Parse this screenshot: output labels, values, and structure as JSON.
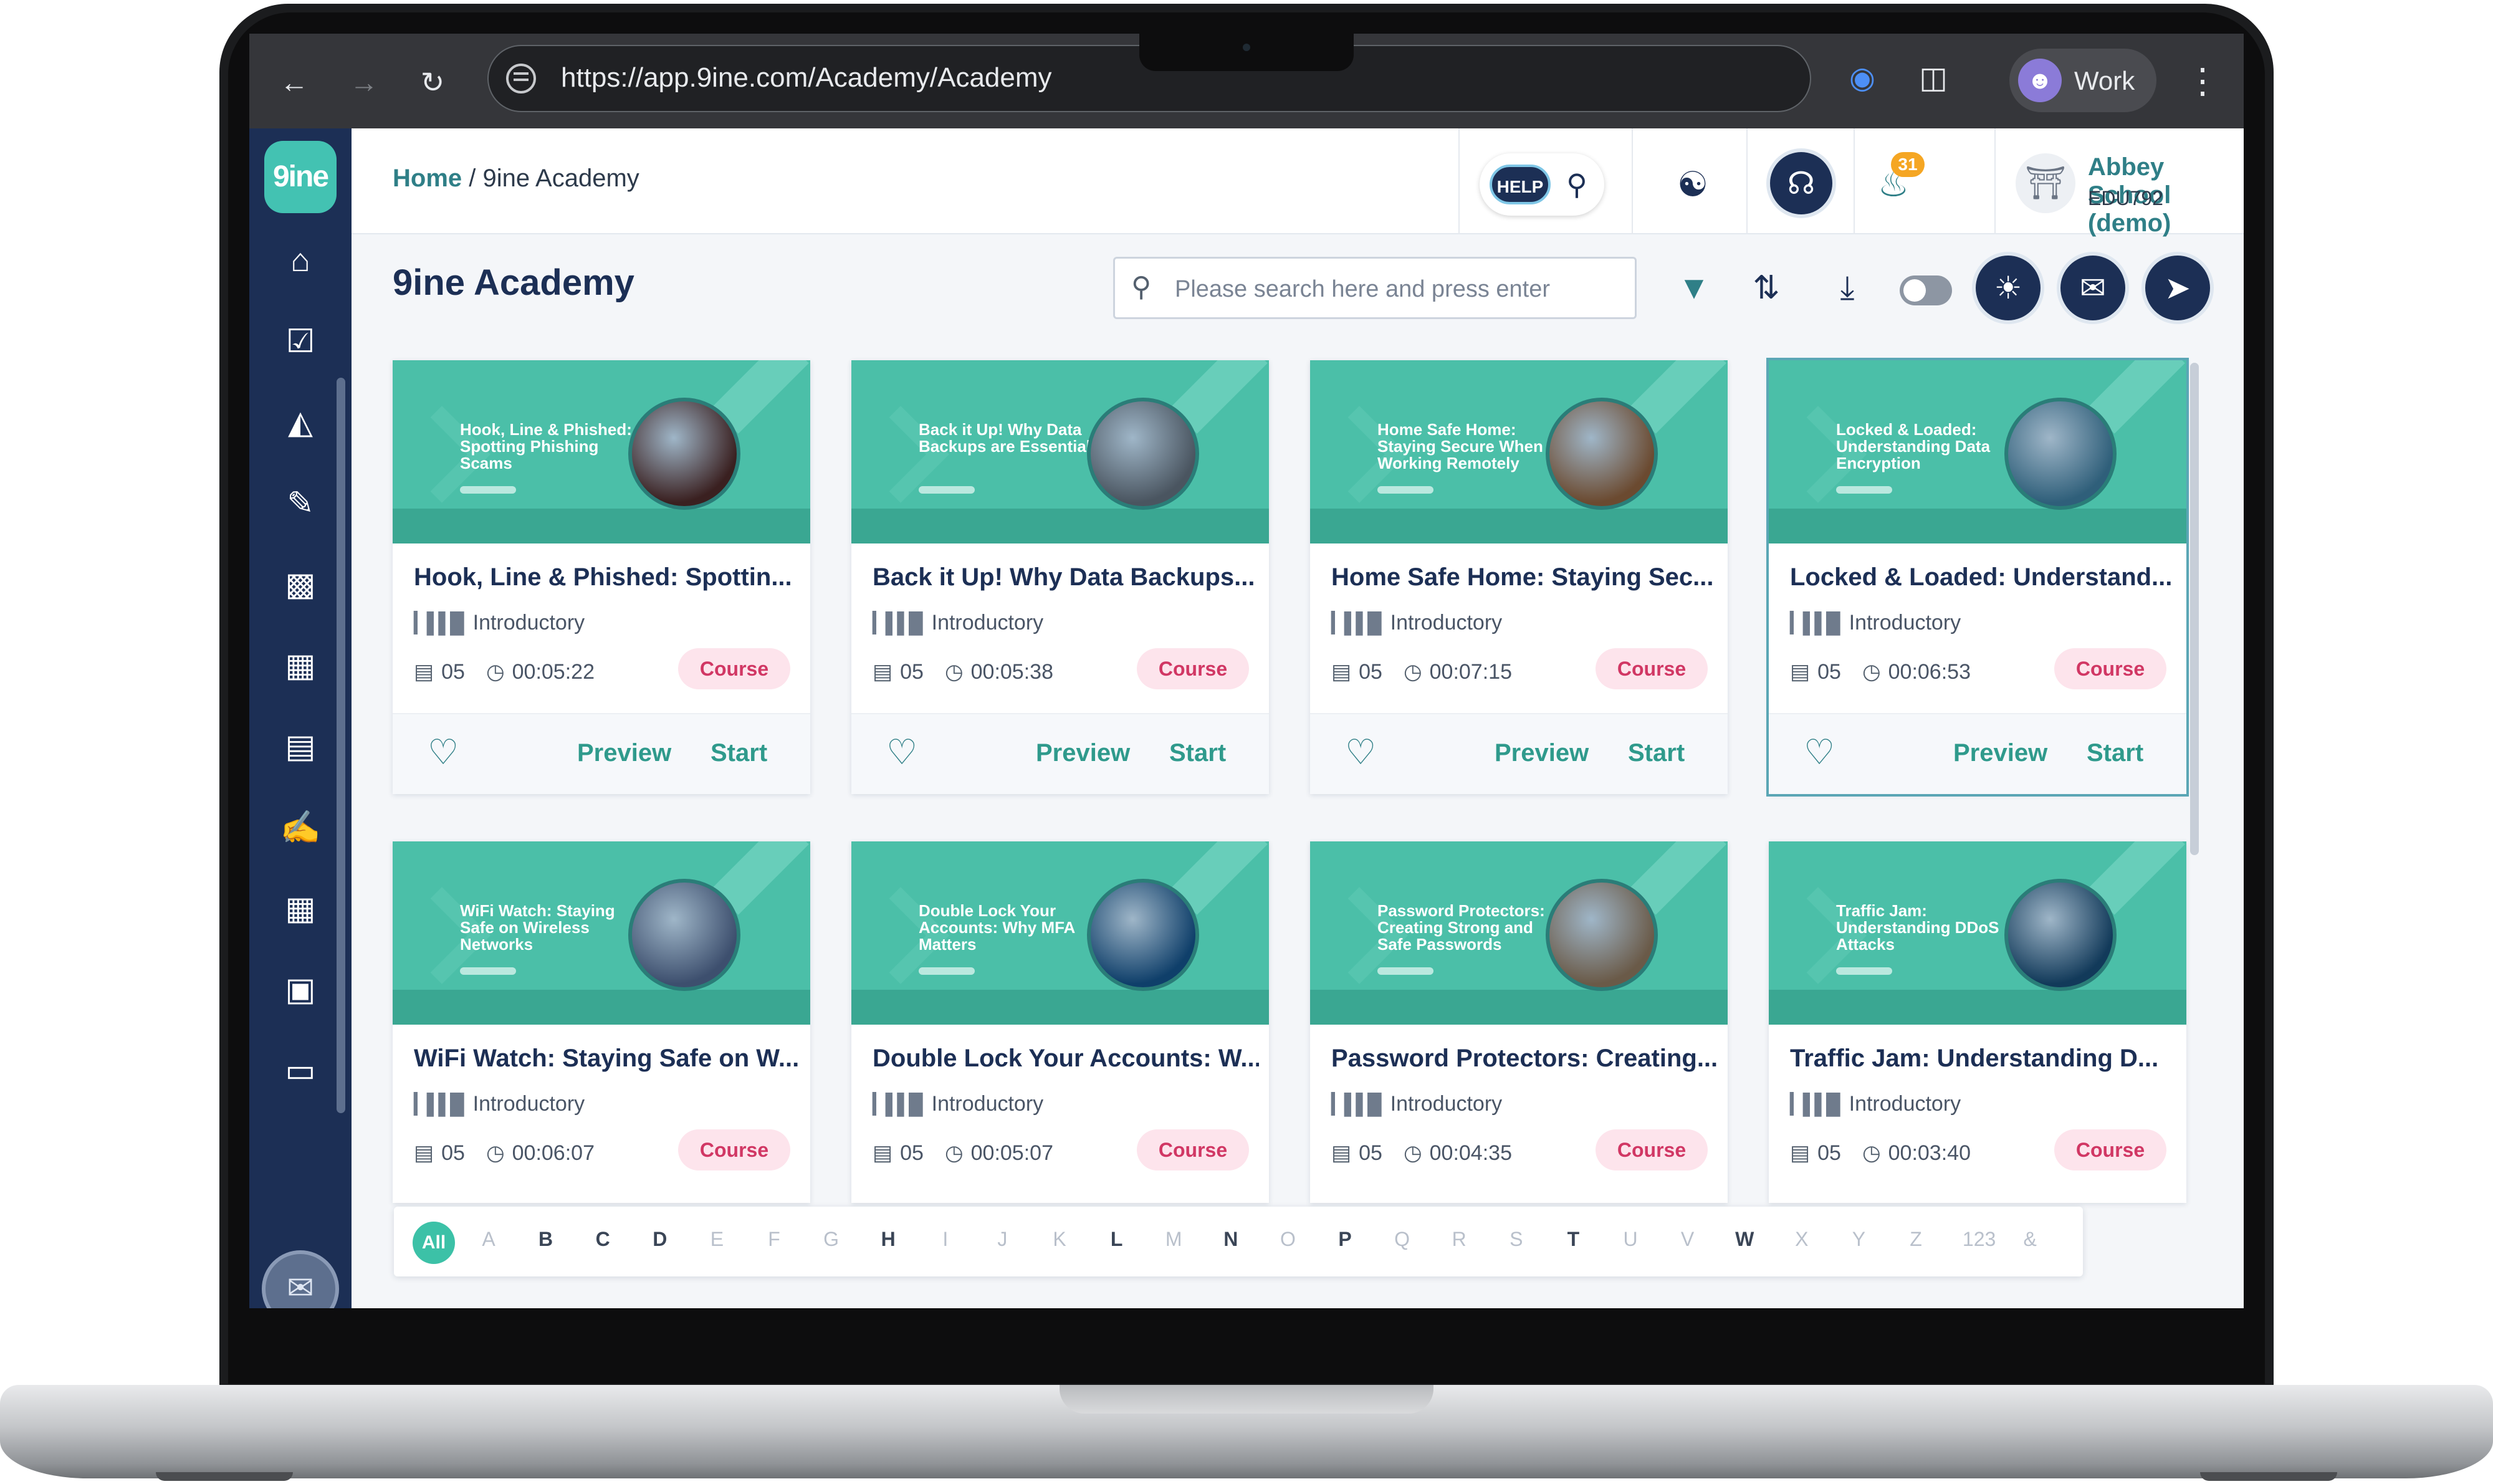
{
  "browser": {
    "url": "https://app.9ine.com/Academy/Academy",
    "profile_label": "Work"
  },
  "sidebar": {
    "logo_text": "9ine",
    "icons": [
      "home-icon",
      "tasks-icon",
      "inbox-icon",
      "document-edit-icon",
      "lock-icon",
      "monitor-settings-icon",
      "monitor-alert-icon",
      "report-edit-icon",
      "building-icon",
      "store-icon",
      "folder-icon"
    ]
  },
  "header": {
    "breadcrumb_home": "Home",
    "breadcrumb_sep": "/",
    "breadcrumb_current": "9ine Academy",
    "help_label": "HELP",
    "notification_count": "31",
    "school_name": "Abbey School (demo)",
    "school_code": "EDU792"
  },
  "main": {
    "title": "9ine Academy",
    "search_placeholder": "Please search here and press enter"
  },
  "courses": [
    {
      "thumb_title": "Hook, Line & Phished: Spotting Phishing Scams",
      "title": "Hook, Line & Phished: Spottin...",
      "level": "Introductory",
      "lessons": "05",
      "duration": "00:05:22",
      "type": "Course",
      "photo_color": "#3a2020"
    },
    {
      "thumb_title": "Back it Up! Why Data Backups are Essential",
      "title": "Back it Up! Why Data Backups...",
      "level": "Introductory",
      "lessons": "05",
      "duration": "00:05:38",
      "type": "Course",
      "photo_color": "#4a5560"
    },
    {
      "thumb_title": "Home Safe Home: Staying Secure When Working Remotely",
      "title": "Home Safe Home: Staying Sec...",
      "level": "Introductory",
      "lessons": "05",
      "duration": "00:07:15",
      "type": "Course",
      "photo_color": "#6b4a30"
    },
    {
      "thumb_title": "Locked & Loaded: Understanding Data Encryption",
      "title": "Locked & Loaded: Understand...",
      "level": "Introductory",
      "lessons": "05",
      "duration": "00:06:53",
      "type": "Course",
      "photo_color": "#2f5f7a"
    },
    {
      "thumb_title": "WiFi Watch: Staying Safe on Wireless Networks",
      "title": "WiFi Watch: Staying Safe on W...",
      "level": "Introductory",
      "lessons": "05",
      "duration": "00:06:07",
      "type": "Course",
      "photo_color": "#3d4f6e"
    },
    {
      "thumb_title": "Double Lock Your Accounts: Why MFA Matters",
      "title": "Double Lock Your Accounts: W...",
      "level": "Introductory",
      "lessons": "05",
      "duration": "00:05:07",
      "type": "Course",
      "photo_color": "#0f3f6a"
    },
    {
      "thumb_title": "Password Protectors: Creating Strong and Safe Passwords",
      "title": "Password Protectors: Creating...",
      "level": "Introductory",
      "lessons": "05",
      "duration": "00:04:35",
      "type": "Course",
      "photo_color": "#6a5a48"
    },
    {
      "thumb_title": "Traffic Jam: Understanding DDoS Attacks",
      "title": "Traffic Jam: Understanding D...",
      "level": "Introductory",
      "lessons": "05",
      "duration": "00:03:40",
      "type": "Course",
      "photo_color": "#123a5a"
    }
  ],
  "card_actions": {
    "preview": "Preview",
    "start": "Start"
  },
  "alphabet": {
    "all": "All",
    "letters": [
      {
        "l": "A",
        "on": false
      },
      {
        "l": "B",
        "on": true
      },
      {
        "l": "C",
        "on": true
      },
      {
        "l": "D",
        "on": true
      },
      {
        "l": "E",
        "on": false
      },
      {
        "l": "F",
        "on": false
      },
      {
        "l": "G",
        "on": false
      },
      {
        "l": "H",
        "on": true
      },
      {
        "l": "I",
        "on": false
      },
      {
        "l": "J",
        "on": false
      },
      {
        "l": "K",
        "on": false
      },
      {
        "l": "L",
        "on": true
      },
      {
        "l": "M",
        "on": false
      },
      {
        "l": "N",
        "on": true
      },
      {
        "l": "O",
        "on": false
      },
      {
        "l": "P",
        "on": true
      },
      {
        "l": "Q",
        "on": false
      },
      {
        "l": "R",
        "on": false
      },
      {
        "l": "S",
        "on": false
      },
      {
        "l": "T",
        "on": true
      },
      {
        "l": "U",
        "on": false
      },
      {
        "l": "V",
        "on": false
      },
      {
        "l": "W",
        "on": true
      },
      {
        "l": "X",
        "on": false
      },
      {
        "l": "Y",
        "on": false
      },
      {
        "l": "Z",
        "on": false
      },
      {
        "l": "123",
        "on": false
      },
      {
        "l": "&",
        "on": false
      }
    ]
  },
  "colors": {
    "brand_teal": "#43c2b2",
    "nav_navy": "#1c2f55",
    "course_pill": "#d13764"
  }
}
